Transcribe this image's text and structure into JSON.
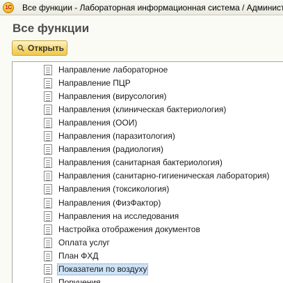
{
  "window": {
    "title": "Все функции - Лабораторная информационная система / Администратор",
    "app_icon_text": "1С"
  },
  "page": {
    "title": "Все функции"
  },
  "toolbar": {
    "open_label": "Открыть",
    "open_icon": "search-icon"
  },
  "list": {
    "item_icon": "document-icon",
    "selected_index": 16,
    "items": [
      {
        "label": "Направление лабораторное"
      },
      {
        "label": "Направление ПЦР"
      },
      {
        "label": "Направления (вирусология)"
      },
      {
        "label": "Направления (клиническая бактериология)"
      },
      {
        "label": "Направления (ООИ)"
      },
      {
        "label": "Направления (паразитология)"
      },
      {
        "label": "Направления (радиология)"
      },
      {
        "label": "Направления (санитарная бактериология)"
      },
      {
        "label": "Направления (санитарно-гигиеническая лаборатория)"
      },
      {
        "label": "Направления (токсикология)"
      },
      {
        "label": "Направления (ФизФактор)"
      },
      {
        "label": "Направления на исследования"
      },
      {
        "label": "Настройка отображения документов"
      },
      {
        "label": "Оплата услуг"
      },
      {
        "label": "План ФХД"
      },
      {
        "label": "Показатели по воздуху"
      },
      {
        "label": "Поручения"
      }
    ]
  },
  "colors": {
    "button_gradient_top": "#fff3c6",
    "button_gradient_bottom": "#efc94a",
    "selection_background": "#cfe3f7",
    "title_text": "#4d4d4d"
  }
}
